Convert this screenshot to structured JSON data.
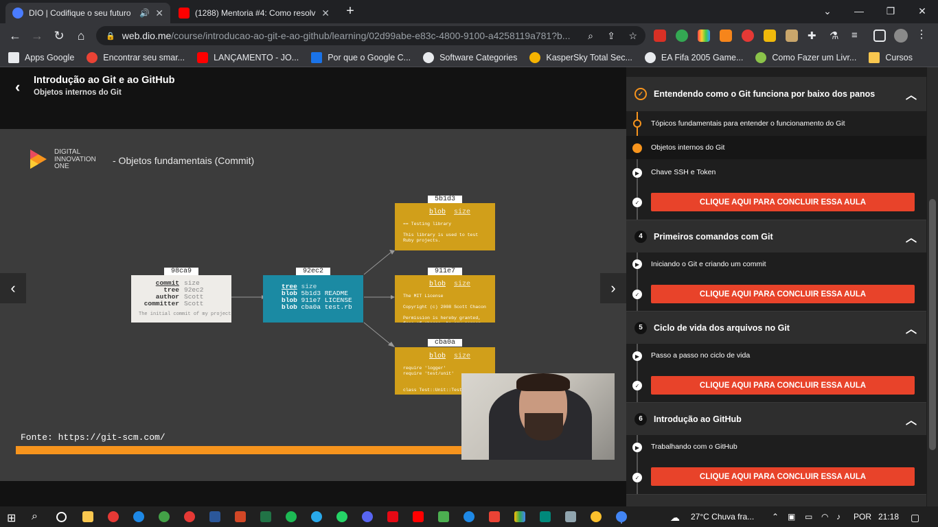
{
  "tabs": [
    {
      "title": "DIO | Codifique o seu futuro",
      "color": "#4a7cff",
      "active": true
    },
    {
      "title": "(1288) Mentoria #4: Como resolv",
      "color": "#ff0000",
      "active": false
    }
  ],
  "new_tab_icon": "+",
  "window_controls": [
    "⌄",
    "—",
    "❐",
    "✕"
  ],
  "address": {
    "host": "web.dio.me",
    "path": "/course/introducao-ao-git-e-ao-github/learning/02d99abe-e83c-4800-9100-a4258119a781?b..."
  },
  "bookmarks": [
    {
      "label": "Apps Google",
      "color": "#e8eaed"
    },
    {
      "label": "Encontrar seu smar...",
      "color": "#ea4335"
    },
    {
      "label": "LANÇAMENTO - JO...",
      "color": "#ff0000"
    },
    {
      "label": "Por que o Google C...",
      "color": "#1a73e8"
    },
    {
      "label": "Software Categories",
      "color": "#e8eaed"
    },
    {
      "label": "KasperSky Total Sec...",
      "color": "#f5b301"
    },
    {
      "label": "EA Fifa 2005 Game...",
      "color": "#e8eaed"
    },
    {
      "label": "Como Fazer um Livr...",
      "color": "#8bc34a"
    },
    {
      "label": "Cursos",
      "color": "#f9c74f"
    }
  ],
  "course": {
    "title": "Introdução ao Git e ao GitHub",
    "subtitle": "Objetos internos do Git"
  },
  "slide": {
    "brand_lines": [
      "DIGITAL",
      "INNOVATION",
      "ONE"
    ],
    "heading": "- Objetos fundamentais (Commit)",
    "commit": {
      "hash": "98ca9",
      "type": "commit",
      "size": "size",
      "rows": [
        [
          "tree",
          "92ec2"
        ],
        [
          "author",
          "Scott"
        ],
        [
          "committer",
          "Scott"
        ]
      ],
      "message": "The initial commit of my project"
    },
    "tree": {
      "hash": "92ec2",
      "type": "tree",
      "size": "size",
      "rows": [
        [
          "blob",
          "5b1d3",
          "README"
        ],
        [
          "blob",
          "911e7",
          "LICENSE"
        ],
        [
          "blob",
          "cba0a",
          "test.rb"
        ]
      ]
    },
    "blobs": [
      {
        "hash": "5b1d3",
        "type": "blob",
        "size": "size",
        "body": "== Testing library\n\nThis library is used to test\nRuby projects."
      },
      {
        "hash": "911e7",
        "type": "blob",
        "size": "size",
        "body": "The MIT License\n\nCopyright (c) 2008 Scott Chacon\n\nPermission is hereby granted,\nfree of charge, to any person"
      },
      {
        "hash": "cba0a",
        "type": "blob",
        "size": "size",
        "body": "require 'logger'\nrequire 'test/unit'\n\n\nclass Test::Unit::TestCase"
      }
    ],
    "source": "Fonte: https://git-scm.com/"
  },
  "sidebar": {
    "sections": [
      {
        "num": "",
        "title": "Entendendo como o Git funciona por baixo dos panos",
        "lessons": [
          "Tópicos fundamentais para entender o funcionamento do Git",
          "Objetos internos do Git",
          "Chave SSH e Token"
        ]
      },
      {
        "num": "4",
        "title": "Primeiros comandos com Git",
        "lessons": [
          "Iniciando o Git e criando um commit"
        ]
      },
      {
        "num": "5",
        "title": "Ciclo de vida dos arquivos no Git",
        "lessons": [
          "Passo a passo no ciclo de vida"
        ]
      },
      {
        "num": "6",
        "title": "Introdução ao GitHub",
        "lessons": [
          "Trabalhando com o GitHub"
        ]
      }
    ],
    "cta_label": "CLIQUE AQUI PARA CONCLUIR ESSA AULA"
  },
  "taskbar": {
    "weather": "27°C  Chuva fra...",
    "lang": "POR",
    "time": "21:18"
  },
  "colors": {
    "accent": "#f7941d",
    "cta": "#e8432a",
    "tree": "#1b8aa3",
    "blob": "#d19f1a"
  }
}
